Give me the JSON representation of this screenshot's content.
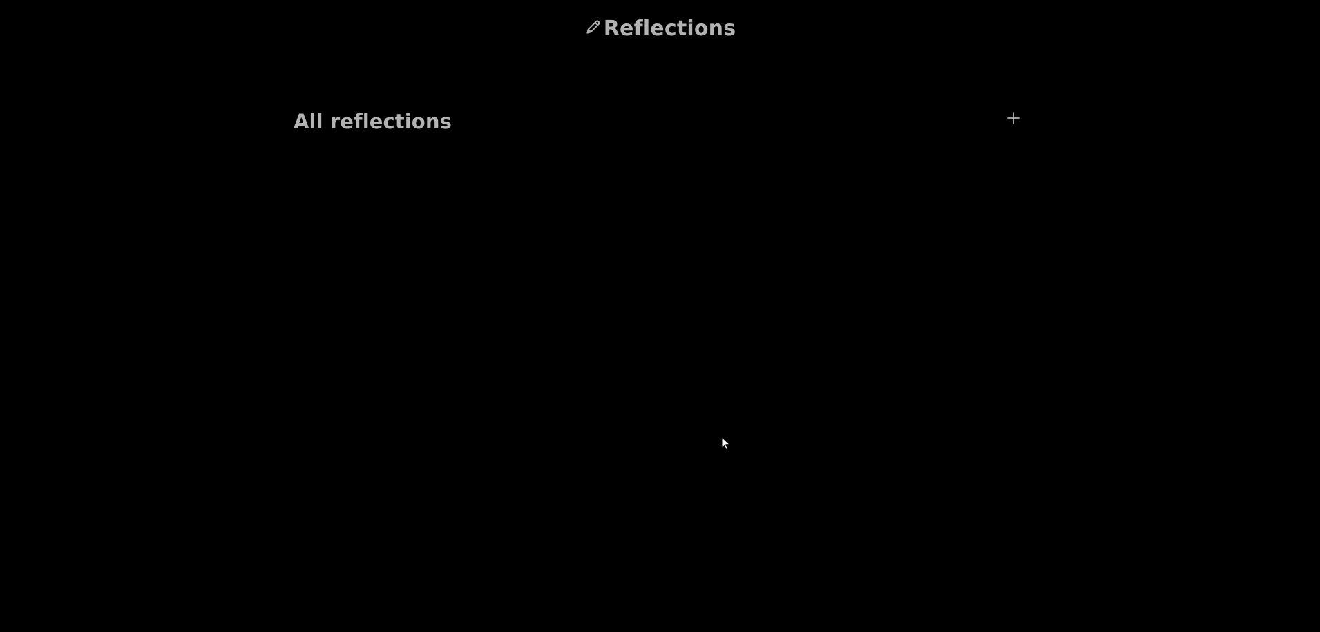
{
  "header": {
    "title": "Reflections",
    "icon": "pencil-icon"
  },
  "main": {
    "section_title": "All reflections",
    "add_button": {
      "icon": "plus-icon"
    },
    "reflections": []
  },
  "colors": {
    "background": "#000000",
    "text": "#b3b3b3",
    "icon": "#b3b3b3"
  }
}
